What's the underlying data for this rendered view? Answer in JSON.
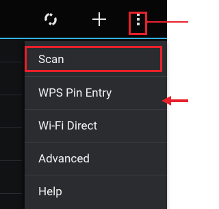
{
  "action_bar": {
    "wps_icon": "wps-icon",
    "add_icon": "plus-icon",
    "overflow_icon": "overflow-menu-icon"
  },
  "menu": {
    "items": [
      {
        "label": "Scan"
      },
      {
        "label": "WPS Pin Entry"
      },
      {
        "label": "Wi-Fi Direct"
      },
      {
        "label": "Advanced"
      },
      {
        "label": "Help"
      }
    ]
  },
  "annotations": {
    "highlight_color": "#e8212c",
    "accent_color": "#33b5e5"
  }
}
